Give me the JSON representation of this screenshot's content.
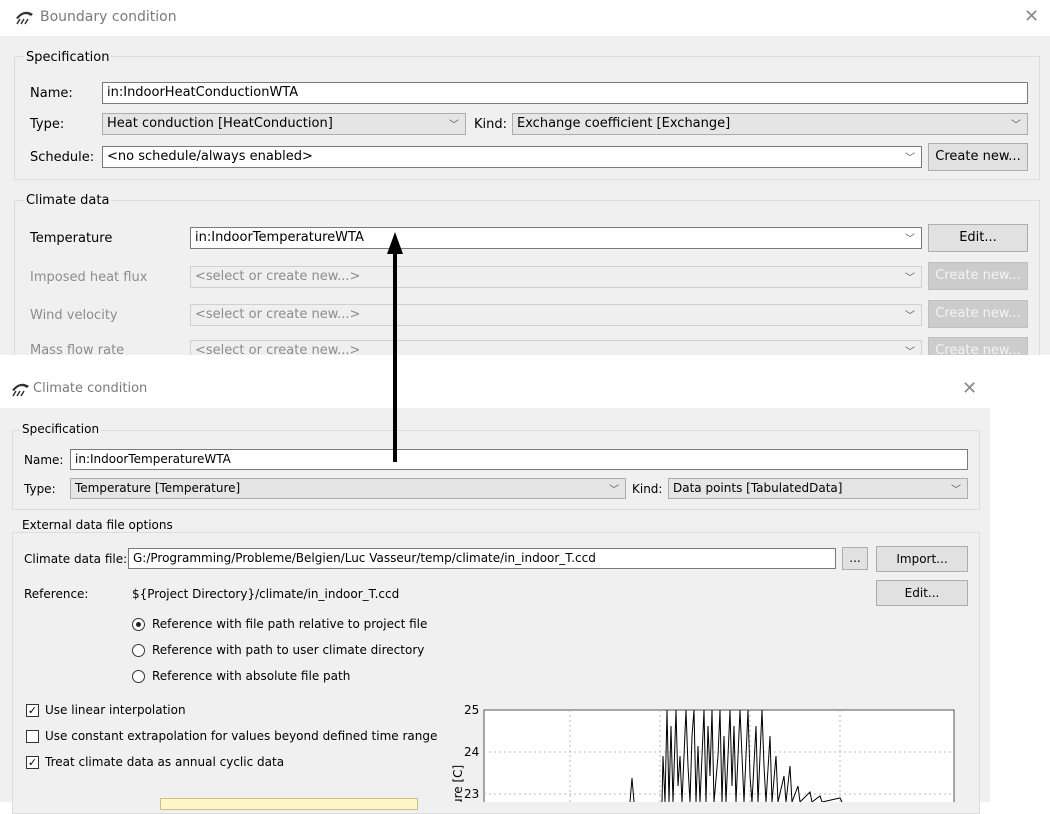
{
  "boundary_dialog": {
    "title": "Boundary condition",
    "specification_title": "Specification",
    "name_label": "Name:",
    "name_value": "in:IndoorHeatConductionWTA",
    "type_label": "Type:",
    "type_value": "Heat conduction [HeatConduction]",
    "kind_label": "Kind:",
    "kind_value": "Exchange coefficient [Exchange]",
    "schedule_label": "Schedule:",
    "schedule_value": "<no schedule/always enabled>",
    "schedule_create_label": "Create new...",
    "climate_title": "Climate data",
    "rows": [
      {
        "label": "Temperature",
        "value": "in:IndoorTemperatureWTA",
        "button": "Edit...",
        "enabled": true
      },
      {
        "label": "Imposed heat flux",
        "value": "<select or create new...>",
        "button": "Create new...",
        "enabled": false
      },
      {
        "label": "Wind velocity",
        "value": "<select or create new...>",
        "button": "Create new...",
        "enabled": false
      },
      {
        "label": "Mass flow rate",
        "value": "<select or create new...>",
        "button": "Create new...",
        "enabled": false
      }
    ]
  },
  "climate_dialog": {
    "title": "Climate condition",
    "specification_title": "Specification",
    "name_label": "Name:",
    "name_value": "in:IndoorTemperatureWTA",
    "type_label": "Type:",
    "type_value": "Temperature [Temperature]",
    "kind_label": "Kind:",
    "kind_value": "Data points [TabulatedData]",
    "external_title": "External data file options",
    "file_label": "Climate data file:",
    "file_value": "G:/Programming/Probleme/Belgien/Luc Vasseur/temp/climate/in_indoor_T.ccd",
    "browse_label": "...",
    "import_label": "Import...",
    "reference_label": "Reference:",
    "reference_value": "${Project Directory}/climate/in_indoor_T.ccd",
    "edit_label": "Edit...",
    "radios": [
      {
        "label": "Reference with file path relative to project file",
        "checked": true
      },
      {
        "label": "Reference with path to user climate directory",
        "checked": false
      },
      {
        "label": "Reference with absolute file path",
        "checked": false
      }
    ],
    "checks": [
      {
        "label": "Use linear interpolation",
        "checked": true
      },
      {
        "label": "Use constant extrapolation for values beyond defined time range",
        "checked": false
      },
      {
        "label": "Treat climate data as annual cyclic data",
        "checked": true
      }
    ],
    "chart_ylabel": "ure [C]",
    "chart_yticks": [
      "25",
      "24",
      "23"
    ]
  },
  "icons": {
    "close": "close-icon",
    "app": "app-logo-icon",
    "arrow": "up-arrow-annotation"
  }
}
